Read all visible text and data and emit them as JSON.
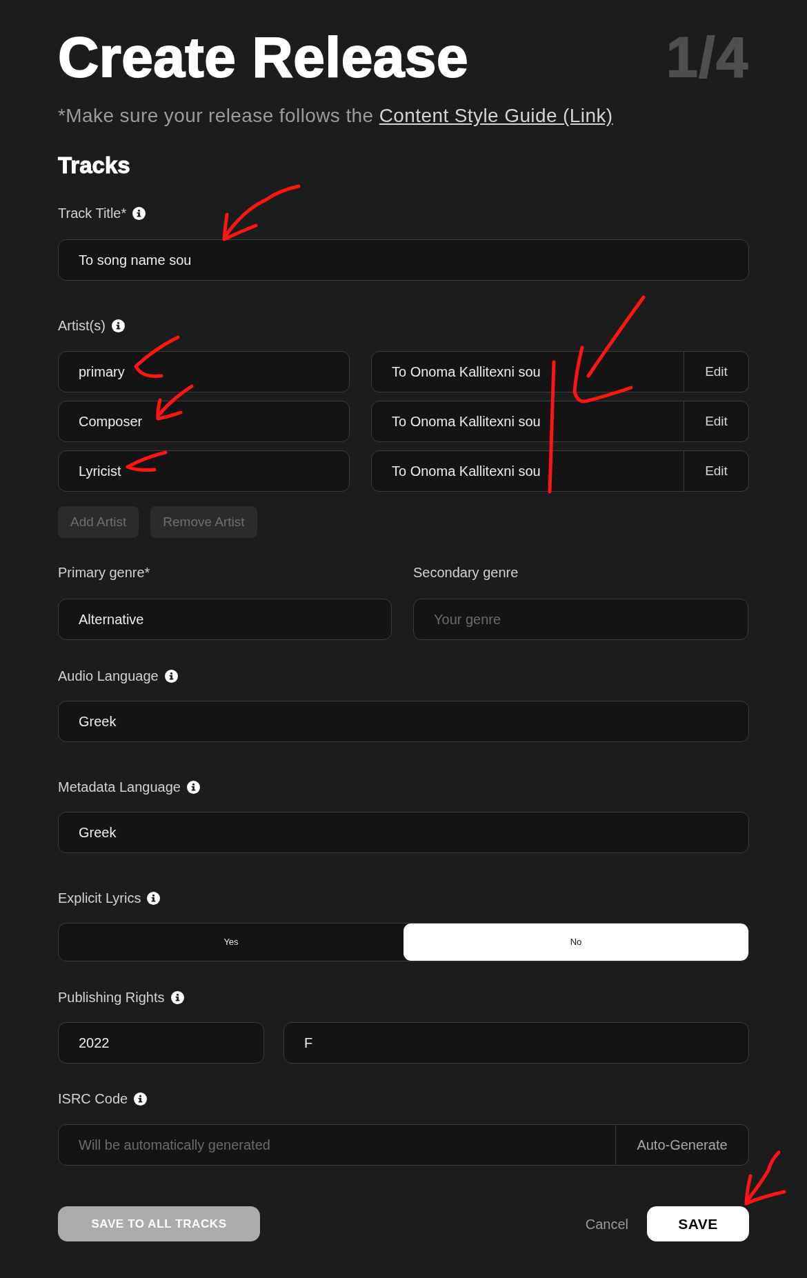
{
  "header": {
    "title": "Create Release",
    "step": "1/4"
  },
  "notice": {
    "text": "*Make sure your release follows the",
    "link": "Content Style Guide (Link)"
  },
  "section_title": "Tracks",
  "track_title": {
    "label": "Track Title*",
    "info": true,
    "value": "To song name sou"
  },
  "artists": {
    "label": "Artist(s)",
    "info": true,
    "rows": [
      {
        "role": "primary",
        "name": "To Onoma Kallitexni sou",
        "action": "Edit"
      },
      {
        "role": "Composer",
        "name": "To Onoma Kallitexni sou",
        "action": "Edit"
      },
      {
        "role": "Lyricist",
        "name": "To Onoma Kallitexni sou",
        "action": "Edit"
      }
    ],
    "buttons": [
      {
        "label": "Add Artist",
        "disabled": true
      },
      {
        "label": "Remove Artist",
        "disabled": true
      }
    ]
  },
  "genres": [
    {
      "label": "Primary genre*",
      "value": "Alternative"
    },
    {
      "label": "Secondary genre",
      "placeholder": "Your genre"
    }
  ],
  "audio_language": {
    "label": "Audio Language",
    "info": true,
    "value": "Greek"
  },
  "metadata_language": {
    "label": "Metadata Language",
    "info": true,
    "value": "Greek"
  },
  "explicit_lyrics": {
    "label": "Explicit Lyrics",
    "info": true,
    "options": [
      {
        "label": "Yes",
        "selected": false
      },
      {
        "label": "No",
        "selected": true
      }
    ]
  },
  "publishing_rights": {
    "label": "Publishing Rights",
    "info": true,
    "year": "2022",
    "owner": "F"
  },
  "isrc_code": {
    "label": "ISRC Code",
    "info": true,
    "placeholder": "Will be automatically generated",
    "action": "Auto-Generate"
  },
  "footer": {
    "save_all": "SAVE TO ALL TRACKS",
    "cancel": "Cancel",
    "save": "SAVE"
  }
}
